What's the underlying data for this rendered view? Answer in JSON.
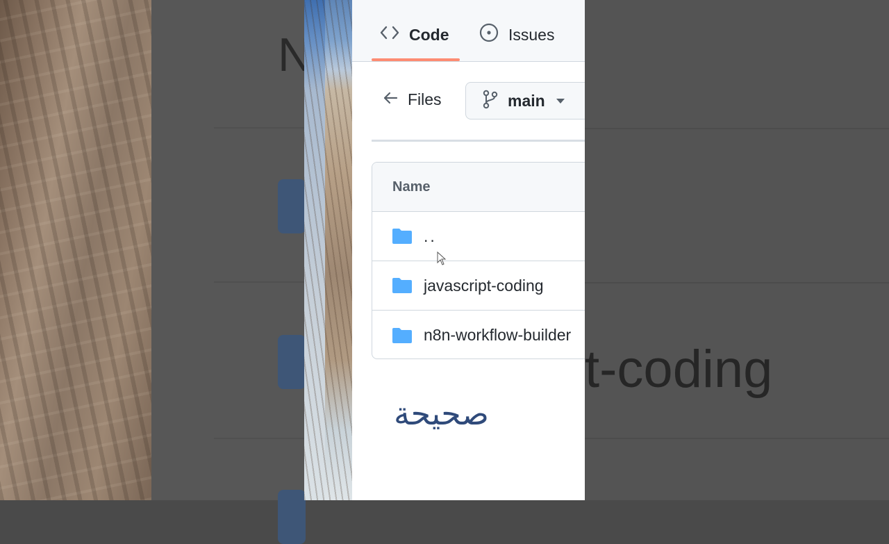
{
  "tabs": [
    {
      "label": "Code",
      "icon": "code-icon",
      "active": true
    },
    {
      "label": "Issues",
      "icon": "issue-opened-icon",
      "active": false
    }
  ],
  "files_bar": {
    "back_label": "Files",
    "branch": "main"
  },
  "file_table": {
    "header": "Name",
    "rows": [
      {
        "name": "..",
        "icon": "folder-icon"
      },
      {
        "name": "javascript-coding",
        "icon": "folder-icon"
      },
      {
        "name": "n8n-workflow-builder",
        "icon": "folder-icon"
      }
    ]
  },
  "overlay_text": "صحيحة",
  "background": {
    "left_fragment": "N",
    "right_fragment": "t-coding"
  },
  "colors": {
    "folder": "#54aeff",
    "active_tab_underline": "#fd8c73",
    "text": "#24292f",
    "overlay_text": "#2f4a7a"
  }
}
